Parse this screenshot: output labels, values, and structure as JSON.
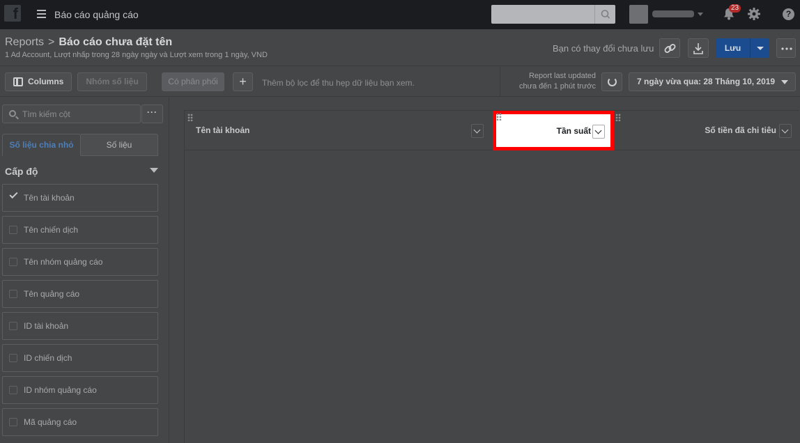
{
  "topbar": {
    "logo_letter": "f",
    "app_title": "Báo cáo quảng cáo",
    "notification_count": "23"
  },
  "header": {
    "breadcrumb_root": "Reports",
    "breadcrumb_sep": ">",
    "report_title": "Báo cáo chưa đặt tên",
    "subtitle": "1 Ad Account, Lượt nhấp trong 28 ngày ngày và Lượt xem trong 1 ngày, VND",
    "unsaved_text": "Bạn có thay đổi chưa lưu",
    "save_label": "Lưu"
  },
  "toolbar": {
    "columns_label": "Columns",
    "metrics_group_label": "Nhóm số liệu",
    "filter_chip_label": "Có phân phối",
    "add_label": "+",
    "filter_hint": "Thêm bộ lọc để thu hẹp dữ liệu bạn xem.",
    "updated_line1": "Report last updated",
    "updated_line2": "chưa đến 1 phút trước",
    "date_range": "7 ngày vừa qua: 28 Tháng 10, 2019"
  },
  "sidebar": {
    "search_placeholder": "Tìm kiếm cột",
    "more_label": "···",
    "tab_breakdowns": "Số liệu chia nhỏ",
    "tab_metrics": "Số liệu",
    "level_label": "Cấp độ",
    "items": [
      {
        "label": "Tên tài khoản",
        "checked": true
      },
      {
        "label": "Tên chiến dịch",
        "checked": false
      },
      {
        "label": "Tên nhóm quảng cáo",
        "checked": false
      },
      {
        "label": "Tên quảng cáo",
        "checked": false
      },
      {
        "label": "ID tài khoản",
        "checked": false
      },
      {
        "label": "ID chiến dịch",
        "checked": false
      },
      {
        "label": "ID nhóm quảng cáo",
        "checked": false
      },
      {
        "label": "Mã quảng cáo",
        "checked": false
      }
    ]
  },
  "table": {
    "columns": [
      "Tên tài khoản",
      "Tần suất",
      "Số tiền đã chi tiêu"
    ],
    "highlighted_column": "Tần suất"
  },
  "colors": {
    "highlight_border": "#ff0000",
    "primary_button": "#1a4c8f",
    "active_tab_text": "#4d7fb9"
  }
}
